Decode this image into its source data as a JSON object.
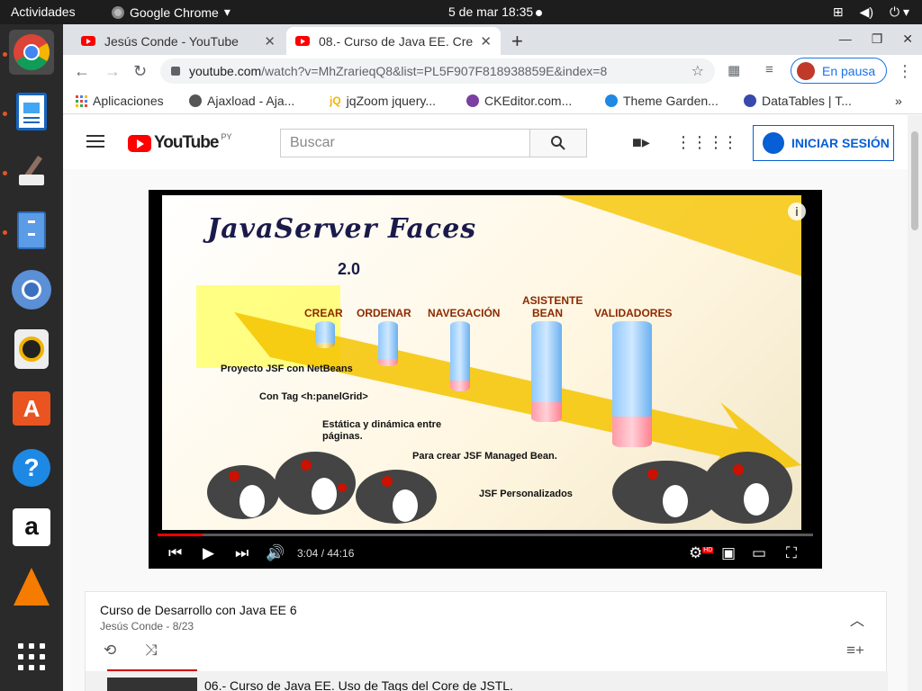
{
  "topbar": {
    "activities": "Actividades",
    "app_name": "Google Chrome",
    "clock": "5 de mar  18:35"
  },
  "dock": {
    "items": [
      "chrome-icon",
      "document-viewer-icon",
      "paint-icon",
      "file-cabinet-icon",
      "chromium-icon",
      "speaker-icon",
      "app-store-icon",
      "help-icon",
      "amazon-icon",
      "vlc-icon",
      "apps-grid-icon"
    ]
  },
  "browser": {
    "tabs": [
      {
        "title": "Jesús Conde - YouTube",
        "active": false
      },
      {
        "title": "08.- Curso de Java EE. Cre",
        "active": true
      }
    ],
    "url_host": "youtube.com",
    "url_path": "/watch?v=MhZrarieqQ8&list=PL5F907F818938859E&index=8",
    "profile_label": "En pausa",
    "bookmarks": [
      {
        "label": "Aplicaciones",
        "color": "#4285f4"
      },
      {
        "label": "Ajaxload - Aja...",
        "color": "#555555"
      },
      {
        "label": "jqZoom jquery...",
        "color": "#f4b400"
      },
      {
        "label": "CKEditor.com...",
        "color": "#7b3fa0"
      },
      {
        "label": "Theme Garden...",
        "color": "#1e88e5"
      },
      {
        "label": "DataTables | T...",
        "color": "#3949ab"
      }
    ],
    "more_bookmarks": "»"
  },
  "youtube": {
    "logo_text": "YouTube",
    "country_code": "PY",
    "search_placeholder": "Buscar",
    "signin_label": "INICIAR SESIÓN",
    "accent": "#ff0000"
  },
  "video": {
    "slide_title": "JavaServer Faces",
    "slide_version": "2.0",
    "columns": [
      {
        "label": "CREAR",
        "desc": "Proyecto JSF con NetBeans"
      },
      {
        "label": "ORDENAR",
        "desc": "Con Tag <h:panelGrid>"
      },
      {
        "label": "NAVEGACIÓN",
        "desc": "Estática y dinámica entre páginas."
      },
      {
        "label": "ASISTENTE BEAN",
        "desc": "Para crear JSF Managed Bean."
      },
      {
        "label": "VALIDADORES",
        "desc": "JSF Personalizados"
      }
    ],
    "time_current": "3:04",
    "time_total": "44:16",
    "progress_fraction": 0.069,
    "quality_badge": "HD"
  },
  "playlist": {
    "title": "Curso de Desarrollo con Java EE 6",
    "subtitle": "Jesús Conde - 8/23",
    "items": [
      {
        "title": "06.- Curso de Java EE. Uso de Tags del Core de JSTL."
      }
    ]
  }
}
